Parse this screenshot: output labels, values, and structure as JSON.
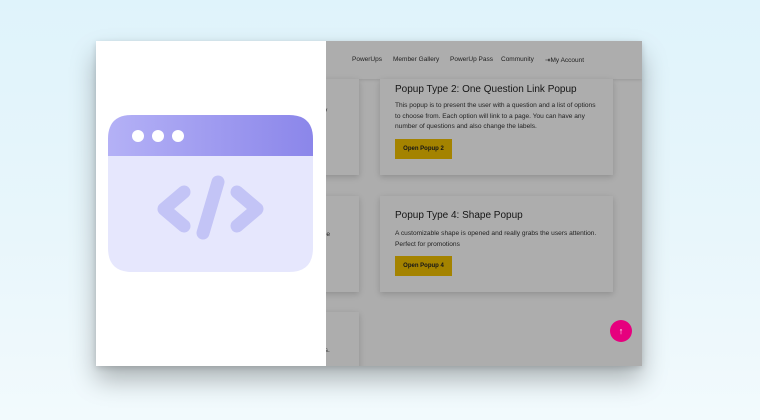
{
  "nav": {
    "items": [
      {
        "label": "PowerUps"
      },
      {
        "label": "Member Gallery"
      },
      {
        "label": "PowerUp Pass"
      },
      {
        "label": "Community"
      },
      {
        "label": "My Account"
      }
    ]
  },
  "cards": {
    "popup2": {
      "title": "Popup Type 2: One Question Link Popup",
      "description": "This popup is to present the user with a question and a list of options to choose from. Each option will link to a page. You can have any number of questions and also change the labels.",
      "button": "Open Popup 2"
    },
    "popup4": {
      "title": "Popup Type 4: Shape Popup",
      "description": "A customizable shape is opened and really grabs the users attention. Perfect for promotions",
      "button": "Open Popup 4"
    },
    "partial": {
      "a": "y",
      "b": "p",
      "c": "age",
      "d": "ns."
    }
  },
  "fab": {
    "icon": "arrow-up-icon",
    "glyph": "↑",
    "color": "#e6007e"
  },
  "panel_icon": {
    "icon": "code-window-icon"
  },
  "colors": {
    "button": "#f2c200",
    "icon_header": "#8b86ea",
    "icon_body": "#e6e7fd",
    "icon_glyph": "#c3c4f6"
  }
}
